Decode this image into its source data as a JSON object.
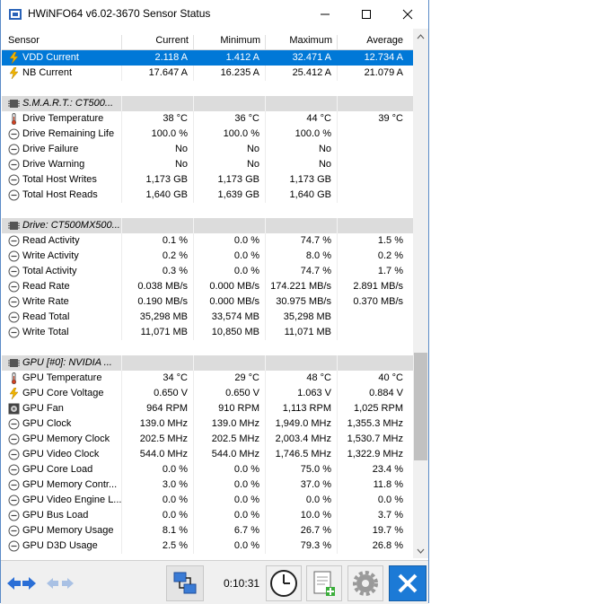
{
  "window": {
    "title": "HWiNFO64 v6.02-3670 Sensor Status"
  },
  "header": {
    "sensor": "Sensor",
    "current": "Current",
    "minimum": "Minimum",
    "maximum": "Maximum",
    "average": "Average"
  },
  "rows": [
    {
      "type": "data",
      "icon": "lightning-icon",
      "name": "VDD Current",
      "cur": "2.118 A",
      "min": "1.412 A",
      "max": "32.471 A",
      "avg": "12.734 A",
      "selected": true
    },
    {
      "type": "data",
      "icon": "lightning-icon",
      "name": "NB Current",
      "cur": "17.647 A",
      "min": "16.235 A",
      "max": "25.412 A",
      "avg": "21.079 A"
    },
    {
      "type": "blank"
    },
    {
      "type": "group",
      "icon": "chip-icon",
      "name": "S.M.A.R.T.: CT500..."
    },
    {
      "type": "data",
      "icon": "thermometer-icon",
      "name": "Drive Temperature",
      "cur": "38 °C",
      "min": "36 °C",
      "max": "44 °C",
      "avg": "39 °C"
    },
    {
      "type": "data",
      "icon": "gauge-icon",
      "name": "Drive Remaining Life",
      "cur": "100.0 %",
      "min": "100.0 %",
      "max": "100.0 %",
      "avg": ""
    },
    {
      "type": "data",
      "icon": "gauge-icon",
      "name": "Drive Failure",
      "cur": "No",
      "min": "No",
      "max": "No",
      "avg": ""
    },
    {
      "type": "data",
      "icon": "gauge-icon",
      "name": "Drive Warning",
      "cur": "No",
      "min": "No",
      "max": "No",
      "avg": ""
    },
    {
      "type": "data",
      "icon": "gauge-icon",
      "name": "Total Host Writes",
      "cur": "1,173 GB",
      "min": "1,173 GB",
      "max": "1,173 GB",
      "avg": ""
    },
    {
      "type": "data",
      "icon": "gauge-icon",
      "name": "Total Host Reads",
      "cur": "1,640 GB",
      "min": "1,639 GB",
      "max": "1,640 GB",
      "avg": ""
    },
    {
      "type": "blank"
    },
    {
      "type": "group",
      "icon": "chip-icon",
      "name": "Drive: CT500MX500..."
    },
    {
      "type": "data",
      "icon": "gauge-icon",
      "name": "Read Activity",
      "cur": "0.1 %",
      "min": "0.0 %",
      "max": "74.7 %",
      "avg": "1.5 %"
    },
    {
      "type": "data",
      "icon": "gauge-icon",
      "name": "Write Activity",
      "cur": "0.2 %",
      "min": "0.0 %",
      "max": "8.0 %",
      "avg": "0.2 %"
    },
    {
      "type": "data",
      "icon": "gauge-icon",
      "name": "Total Activity",
      "cur": "0.3 %",
      "min": "0.0 %",
      "max": "74.7 %",
      "avg": "1.7 %"
    },
    {
      "type": "data",
      "icon": "gauge-icon",
      "name": "Read Rate",
      "cur": "0.038 MB/s",
      "min": "0.000 MB/s",
      "max": "174.221 MB/s",
      "avg": "2.891 MB/s"
    },
    {
      "type": "data",
      "icon": "gauge-icon",
      "name": "Write Rate",
      "cur": "0.190 MB/s",
      "min": "0.000 MB/s",
      "max": "30.975 MB/s",
      "avg": "0.370 MB/s"
    },
    {
      "type": "data",
      "icon": "gauge-icon",
      "name": "Read Total",
      "cur": "35,298 MB",
      "min": "33,574 MB",
      "max": "35,298 MB",
      "avg": ""
    },
    {
      "type": "data",
      "icon": "gauge-icon",
      "name": "Write Total",
      "cur": "11,071 MB",
      "min": "10,850 MB",
      "max": "11,071 MB",
      "avg": ""
    },
    {
      "type": "blank"
    },
    {
      "type": "group",
      "icon": "chip-icon",
      "name": "GPU [#0]: NVIDIA ..."
    },
    {
      "type": "data",
      "icon": "thermometer-icon",
      "name": "GPU Temperature",
      "cur": "34 °C",
      "min": "29 °C",
      "max": "48 °C",
      "avg": "40 °C"
    },
    {
      "type": "data",
      "icon": "lightning-icon",
      "name": "GPU Core Voltage",
      "cur": "0.650 V",
      "min": "0.650 V",
      "max": "1.063 V",
      "avg": "0.884 V"
    },
    {
      "type": "data",
      "icon": "fan-icon",
      "name": "GPU Fan",
      "cur": "964 RPM",
      "min": "910 RPM",
      "max": "1,113 RPM",
      "avg": "1,025 RPM"
    },
    {
      "type": "data",
      "icon": "gauge-icon",
      "name": "GPU Clock",
      "cur": "139.0 MHz",
      "min": "139.0 MHz",
      "max": "1,949.0 MHz",
      "avg": "1,355.3 MHz"
    },
    {
      "type": "data",
      "icon": "gauge-icon",
      "name": "GPU Memory Clock",
      "cur": "202.5 MHz",
      "min": "202.5 MHz",
      "max": "2,003.4 MHz",
      "avg": "1,530.7 MHz"
    },
    {
      "type": "data",
      "icon": "gauge-icon",
      "name": "GPU Video Clock",
      "cur": "544.0 MHz",
      "min": "544.0 MHz",
      "max": "1,746.5 MHz",
      "avg": "1,322.9 MHz"
    },
    {
      "type": "data",
      "icon": "gauge-icon",
      "name": "GPU Core Load",
      "cur": "0.0 %",
      "min": "0.0 %",
      "max": "75.0 %",
      "avg": "23.4 %"
    },
    {
      "type": "data",
      "icon": "gauge-icon",
      "name": "GPU Memory Contr...",
      "cur": "3.0 %",
      "min": "0.0 %",
      "max": "37.0 %",
      "avg": "11.8 %"
    },
    {
      "type": "data",
      "icon": "gauge-icon",
      "name": "GPU Video Engine L...",
      "cur": "0.0 %",
      "min": "0.0 %",
      "max": "0.0 %",
      "avg": "0.0 %"
    },
    {
      "type": "data",
      "icon": "gauge-icon",
      "name": "GPU Bus Load",
      "cur": "0.0 %",
      "min": "0.0 %",
      "max": "10.0 %",
      "avg": "3.7 %"
    },
    {
      "type": "data",
      "icon": "gauge-icon",
      "name": "GPU Memory Usage",
      "cur": "8.1 %",
      "min": "6.7 %",
      "max": "26.7 %",
      "avg": "19.7 %"
    },
    {
      "type": "data",
      "icon": "gauge-icon",
      "name": "GPU D3D Usage",
      "cur": "2.5 %",
      "min": "0.0 %",
      "max": "79.3 %",
      "avg": "26.8 %"
    }
  ],
  "toolbar": {
    "timer": "0:10:31"
  },
  "colors": {
    "selection": "#0078d7",
    "accent": "#1e6fd0",
    "lightning": "#f0b400",
    "close_bg": "#1c7ad6"
  }
}
